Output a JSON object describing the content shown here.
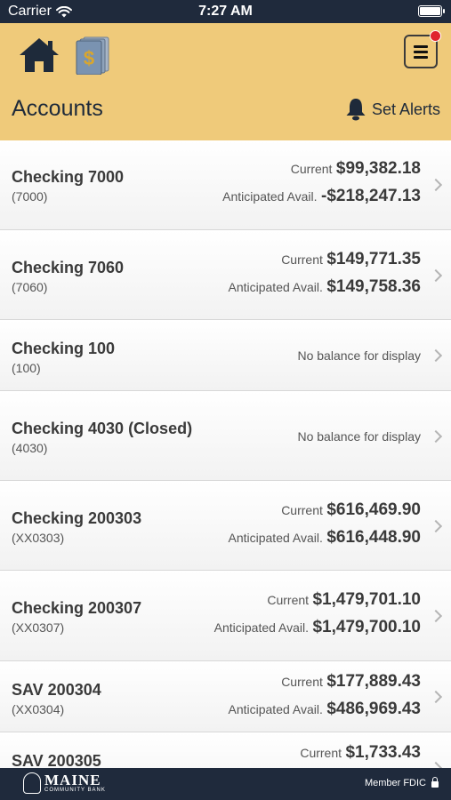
{
  "status_bar": {
    "carrier": "Carrier",
    "time": "7:27 AM"
  },
  "header": {
    "title": "Accounts",
    "alerts_label": "Set Alerts"
  },
  "accounts": [
    {
      "name": "Checking 7000",
      "number": "(7000)",
      "current_label": "Current",
      "current": "$99,382.18",
      "anticipated_label": "Anticipated Avail.",
      "anticipated": "-$218,247.13"
    },
    {
      "name": "Checking 7060",
      "number": "(7060)",
      "current_label": "Current",
      "current": "$149,771.35",
      "anticipated_label": "Anticipated Avail.",
      "anticipated": "$149,758.36"
    },
    {
      "name": "Checking 100",
      "number": "(100)",
      "no_balance": "No balance for display"
    },
    {
      "name": "Checking 4030 (Closed)",
      "number": "(4030)",
      "no_balance": "No balance for display"
    },
    {
      "name": "Checking 200303",
      "number": "(XX0303)",
      "current_label": "Current",
      "current": "$616,469.90",
      "anticipated_label": "Anticipated Avail.",
      "anticipated": "$616,448.90"
    },
    {
      "name": "Checking 200307",
      "number": "(XX0307)",
      "current_label": "Current",
      "current": "$1,479,701.10",
      "anticipated_label": "Anticipated Avail.",
      "anticipated": "$1,479,700.10"
    },
    {
      "name": "SAV 200304",
      "number": "(XX0304)",
      "current_label": "Current",
      "current": "$177,889.43",
      "anticipated_label": "Anticipated Avail.",
      "anticipated": "$486,969.43"
    },
    {
      "name": "SAV 200305",
      "number": "",
      "current_label": "Current",
      "current": "$1,733.43"
    }
  ],
  "footer": {
    "logo_name": "MAINE",
    "logo_sub": "COMMUNITY BANK",
    "member_fdic": "Member FDIC"
  },
  "icons": [
    "wifi-icon",
    "battery-icon",
    "home-icon",
    "money-icon",
    "menu-icon",
    "bell-icon",
    "chevron-right-icon",
    "lock-icon",
    "bank-logo-icon"
  ],
  "colors": {
    "header_bg": "#efca7a",
    "bar_bg": "#1f2a3c",
    "notification_dot": "#e0242e"
  }
}
